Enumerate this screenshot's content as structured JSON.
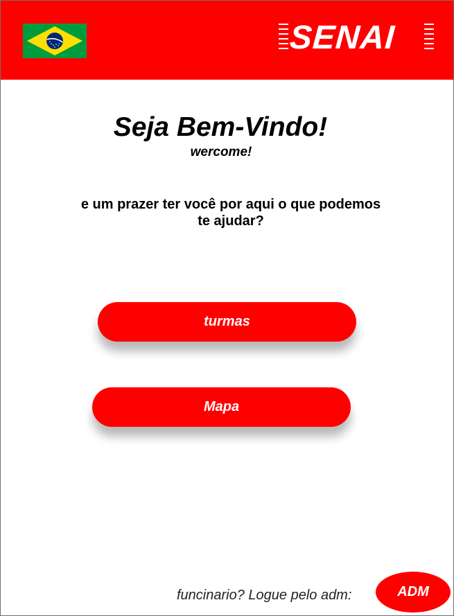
{
  "header": {
    "flag_icon": "brazil-flag-icon",
    "logo_text": "SENAI",
    "background_color": "#ff0000"
  },
  "welcome": {
    "title": "Seja Bem-Vindo!",
    "subtitle": "wercome!",
    "intro_line1": "e um prazer ter você por aqui o que podemos",
    "intro_line2": "te ajudar?"
  },
  "actions": {
    "turmas_label": "turmas",
    "mapa_label": "Mapa"
  },
  "footer": {
    "prompt": "funcinario?  Logue pelo adm:",
    "adm_label": "ADM"
  },
  "colors": {
    "accent": "#ff0000",
    "text": "#000000",
    "background": "#ffffff"
  }
}
